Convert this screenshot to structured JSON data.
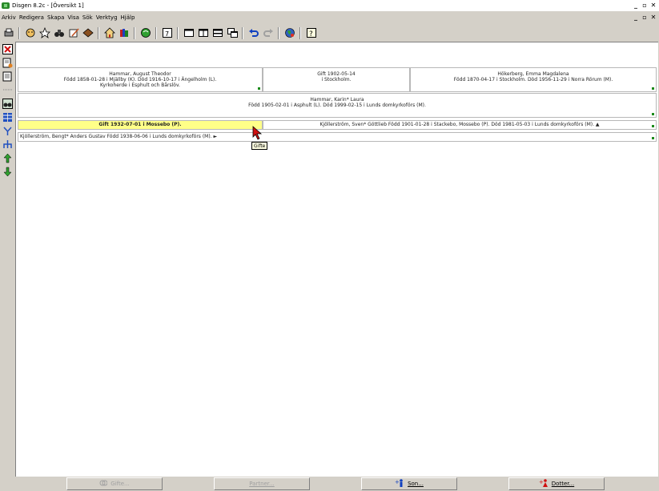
{
  "window": {
    "title": "Disgen 8.2c - [Översikt 1]"
  },
  "menu": [
    "Arkiv",
    "Redigera",
    "Skapa",
    "Visa",
    "Sök",
    "Verktyg",
    "Hjälp"
  ],
  "boxes": {
    "father": {
      "name": "Hammar, August Theodor",
      "line2": "Född 1858-01-28 i Mjällby (K). Död 1916-10-17 i Ängelholm (L).",
      "line3": "Kyrkoherde i Esphult och Bårslöv."
    },
    "parents_marriage": {
      "line1": "Gift 1902-05-14",
      "line2": "i Stockholm."
    },
    "mother": {
      "name": "Hökerberg, Emma Magdalena",
      "line2": "Född 1870-04-17 i Stockholm. Död 1956-11-29 i Norra Rörum (M)."
    },
    "subject": {
      "name": "Hammar, Karin* Laura",
      "line2": "Född 1905-02-01 i Asphult (L). Död 1999-02-15 i Lunds domkyrkoförs (M)."
    },
    "marriage": {
      "text": "Gift 1932-07-01 i Mossebo (P)."
    },
    "spouse": {
      "text": "Kjöllerström, Sven* Göttlieb Född 1901-01-28 i Stackebo, Mossebo (P). Död 1981-05-03 i Lunds domkyrkoförs (M). ▲"
    },
    "child": {
      "text": "Kjöllerström, Bengt* Anders Gustav Född 1938-06-06 i Lunds domkyrkoförs (M). ►"
    }
  },
  "tooltip": "Gifte",
  "bottom": {
    "gifte": "Gifte...",
    "partner": "Partner...",
    "son": "Son...",
    "dotter": "Dotter..."
  },
  "colors": {
    "highlight": "#ffff88",
    "marker": "#1a8a1a"
  }
}
